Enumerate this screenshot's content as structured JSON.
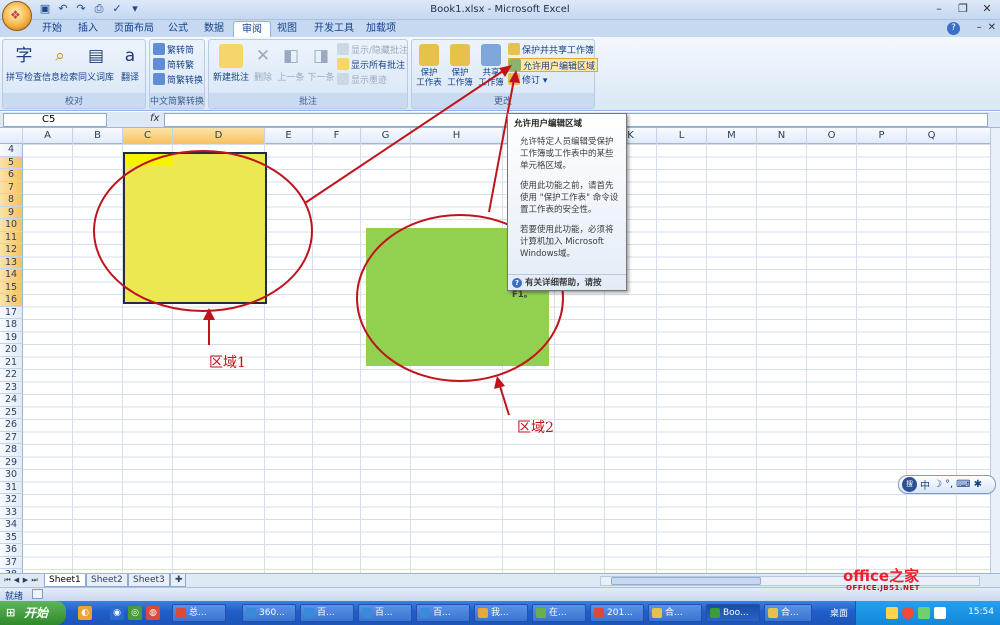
{
  "window": {
    "title": "Book1.xlsx - Microsoft Excel",
    "quick_access": [
      "save-icon",
      "undo-icon",
      "redo-icon",
      "print-icon",
      "spelling-icon",
      "dropdown-icon"
    ]
  },
  "ribbon_tabs": [
    "开始",
    "插入",
    "页面布局",
    "公式",
    "数据",
    "审阅",
    "视图",
    "开发工具",
    "加载项"
  ],
  "active_tab": "审阅",
  "ribbon": {
    "proofing": {
      "label": "校对",
      "spelling": "拼写检查",
      "research": "信息检索",
      "thesaurus": "同义词库",
      "translate": "翻译"
    },
    "chinese_conversion": {
      "label": "中文简繁转换",
      "to_simplified": "繁转简",
      "to_traditional": "简转繁",
      "convert": "简繁转换"
    },
    "comments": {
      "label": "批注",
      "new": "新建批注",
      "delete": "删除",
      "previous": "上一条",
      "next": "下一条",
      "show_hide": "显示/隐藏批注",
      "show_all": "显示所有批注",
      "show_ink": "显示墨迹"
    },
    "changes": {
      "label": "更改",
      "protect_sheet": "保护\n工作表",
      "protect_workbook": "保护\n工作簿",
      "share_workbook": "共享\n工作簿",
      "protect_share": "保护并共享工作簿",
      "allow_edit_ranges": "允许用户编辑区域",
      "track_changes": "修订"
    }
  },
  "formula_bar": {
    "name_box": "C5",
    "fx": "fx",
    "formula": ""
  },
  "grid": {
    "columns": [
      "A",
      "B",
      "C",
      "D",
      "E",
      "F",
      "G",
      "H",
      "I",
      "J",
      "K",
      "L",
      "M",
      "N",
      "O",
      "P",
      "Q"
    ],
    "selected_columns": [
      "C",
      "D"
    ],
    "rows": [
      "4",
      "5",
      "6",
      "7",
      "8",
      "9",
      "10",
      "11",
      "12",
      "13",
      "14",
      "15",
      "16",
      "17",
      "18",
      "19",
      "20",
      "21",
      "22",
      "23",
      "24",
      "25",
      "26",
      "27",
      "28",
      "29",
      "30",
      "31",
      "32",
      "33",
      "34",
      "35",
      "36",
      "37",
      "38"
    ],
    "selected_rows": [
      "5",
      "6",
      "7",
      "8",
      "9",
      "10",
      "11",
      "12",
      "13",
      "14",
      "15",
      "16"
    ]
  },
  "annotations": {
    "region1": "区域1",
    "region2": "区域2",
    "color": "#c0141c"
  },
  "tooltip": {
    "title": "允许用户编辑区域",
    "p1": "允许特定人员编辑受保护工作簿或工作表中的某些单元格区域。",
    "p2": "使用此功能之前，请首先使用 \"保护工作表\" 命令设置工作表的安全性。",
    "p3": "若要使用此功能，必须将计算机加入 Microsoft Windows域。",
    "footer": "有关详细帮助，请按 F1。"
  },
  "sheets": [
    "Sheet1",
    "Sheet2",
    "Sheet3"
  ],
  "active_sheet": "Sheet1",
  "status": "就绪",
  "watermark": {
    "main": "office之家",
    "sub": "OFFICE.JB51.NET"
  },
  "ime": {
    "logo": "搜",
    "mode": "中"
  },
  "taskbar": {
    "start": "开始",
    "buttons": [
      "总...",
      "360...",
      "百...",
      "百...",
      "百...",
      "我...",
      "在...",
      "201...",
      "合...",
      "Boo...",
      "合..."
    ],
    "desktop_label": "桌面",
    "clock": "15:54"
  },
  "colors": {
    "yellow_region": "#ece850",
    "green_region": "#92d050",
    "ribbon_blue": "#15428b"
  }
}
